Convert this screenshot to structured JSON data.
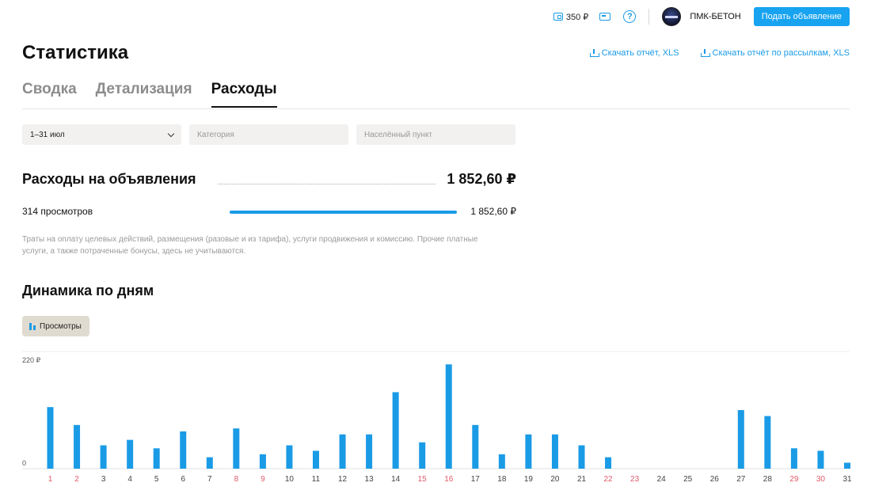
{
  "header": {
    "balance": "350 ₽",
    "company": "ПМК-БЕТОН",
    "post_button": "Подать объявление",
    "help": "?"
  },
  "page": {
    "title": "Статистика",
    "download_report": "Скачать отчёт, XLS",
    "download_mailing_report": "Скачать отчёт по рассылкам, XLS"
  },
  "tabs": [
    {
      "label": "Сводка"
    },
    {
      "label": "Детализация"
    },
    {
      "label": "Расходы"
    }
  ],
  "filters": {
    "period": "1–31 июл",
    "category_placeholder": "Категория",
    "locality_placeholder": "Населённый пункт"
  },
  "expenses": {
    "title": "Расходы на объявления",
    "total": "1 852,60 ₽",
    "views_label": "314 просмотров",
    "views_amount": "1 852,60 ₽",
    "views_share": 1.0,
    "note": "Траты на оплату целевых действий, размещения (разовые и из тарифа), услуги продвижения и комиссию. Прочие платные услуги, а также потраченные бонусы, здесь не учитываются."
  },
  "dynamics": {
    "title": "Динамика по дням",
    "legend": "Просмотры"
  },
  "colors": {
    "accent": "#1a9be6",
    "weekend": "#e05a6a",
    "legend_bg": "#e0dbd0"
  },
  "chart_data": {
    "type": "bar",
    "categories": [
      "1",
      "2",
      "3",
      "4",
      "5",
      "6",
      "7",
      "8",
      "9",
      "10",
      "11",
      "12",
      "13",
      "14",
      "15",
      "16",
      "17",
      "18",
      "19",
      "20",
      "21",
      "22",
      "23",
      "24",
      "25",
      "26",
      "27",
      "28",
      "29",
      "30",
      "31"
    ],
    "weekend_categories": [
      "1",
      "2",
      "8",
      "9",
      "15",
      "16",
      "22",
      "23",
      "29",
      "30"
    ],
    "values": [
      124,
      88,
      47,
      58,
      41,
      75,
      23,
      81,
      29,
      47,
      36,
      69,
      69,
      154,
      53,
      210,
      88,
      29,
      69,
      69,
      47,
      23,
      0,
      0,
      0,
      0,
      118,
      106,
      41,
      36,
      12
    ],
    "ytick_labels": [
      "0",
      "220 ₽"
    ],
    "ylim": [
      0,
      220
    ],
    "grid": false
  }
}
